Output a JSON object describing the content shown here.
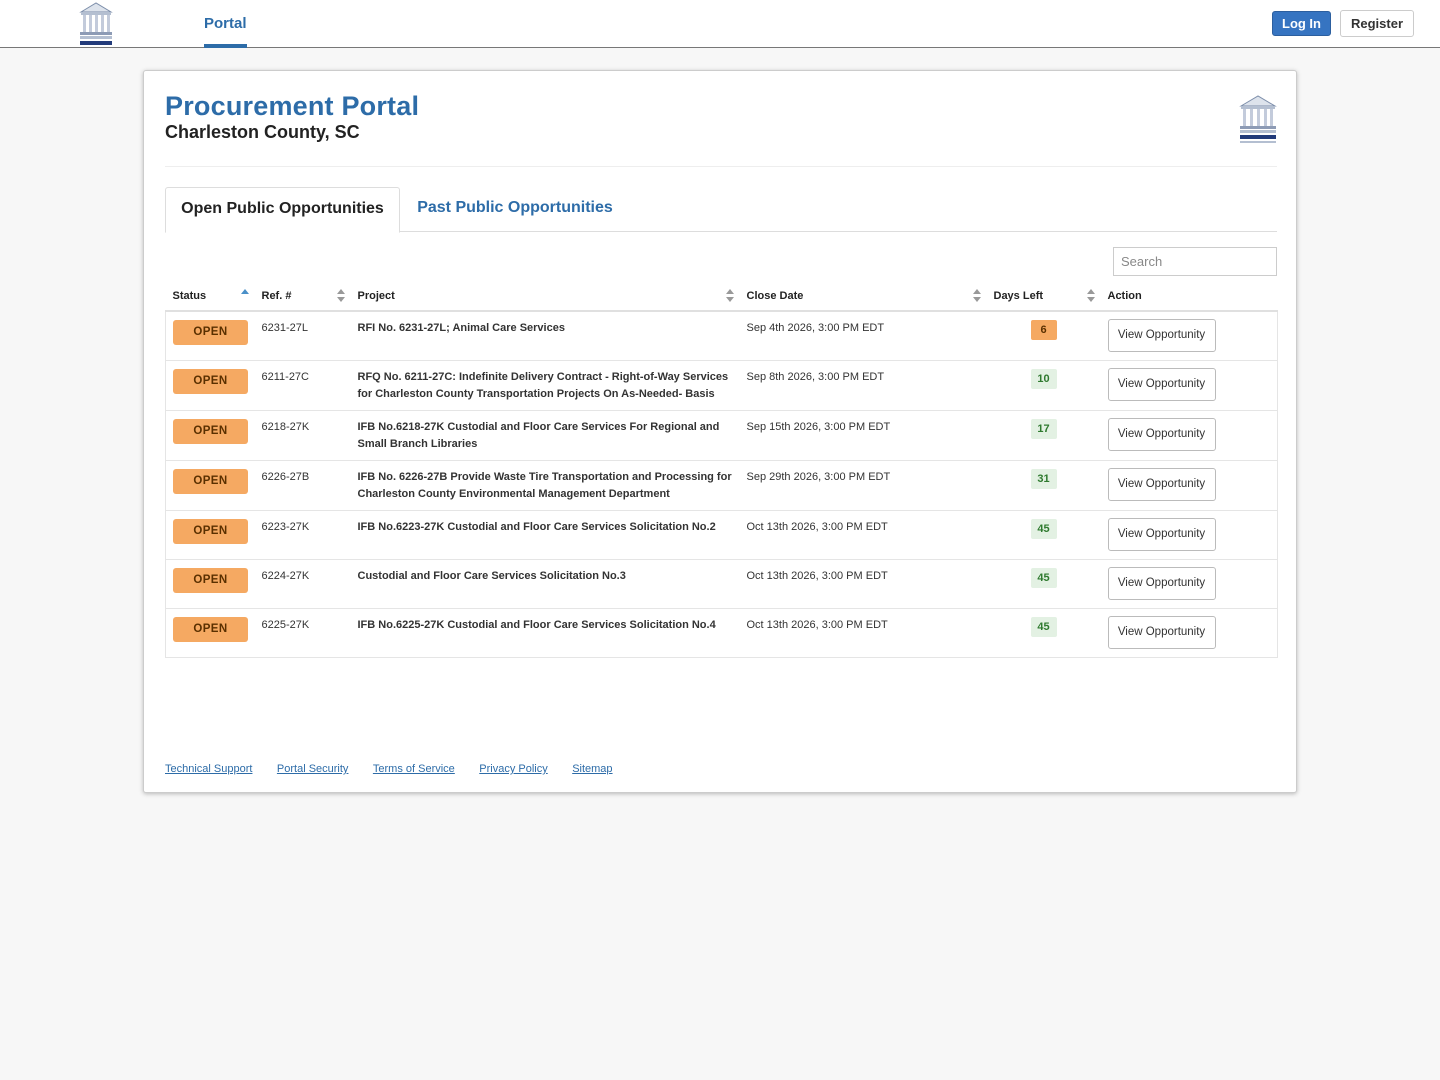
{
  "nav": {
    "logo_icon": "charleston-county-seal-icon",
    "portal_tab": "Portal",
    "login_label": "Log In",
    "register_label": "Register"
  },
  "header": {
    "title": "Procurement Portal",
    "subtitle": "Charleston County, SC",
    "logo_icon": "charleston-county-seal-icon"
  },
  "tabs": {
    "open_label": "Open Public Opportunities",
    "past_label": "Past Public Opportunities"
  },
  "search": {
    "placeholder": "Search"
  },
  "table": {
    "columns": {
      "status": "Status",
      "ref": "Ref. #",
      "project": "Project",
      "close_date": "Close Date",
      "days_left": "Days Left",
      "action": "Action"
    },
    "sorted_column": "Status",
    "sort_direction": "ascending",
    "rows": [
      {
        "status": "OPEN",
        "ref": "6231-27L",
        "project": "RFI No. 6231-27L; Animal Care Services",
        "close_date": "Sep 4th 2026, 3:00 PM EDT",
        "days_left": "6",
        "action": "View Opportunity"
      },
      {
        "status": "OPEN",
        "ref": "6211-27C",
        "project": "RFQ No. 6211-27C: Indefinite Delivery Contract - Right-of-Way Services for Charleston County Transportation Projects On As-Needed- Basis",
        "close_date": "Sep 8th 2026, 3:00 PM EDT",
        "days_left": "10",
        "action": "View Opportunity"
      },
      {
        "status": "OPEN",
        "ref": "6218-27K",
        "project": "IFB No.6218-27K Custodial and Floor Care Services For Regional and Small Branch Libraries",
        "close_date": "Sep 15th 2026, 3:00 PM EDT",
        "days_left": "17",
        "action": "View Opportunity"
      },
      {
        "status": "OPEN",
        "ref": "6226-27B",
        "project": "IFB No. 6226-27B Provide Waste Tire Transportation and Processing for Charleston County Environmental Management Department",
        "close_date": "Sep 29th 2026, 3:00 PM EDT",
        "days_left": "31",
        "action": "View Opportunity"
      },
      {
        "status": "OPEN",
        "ref": "6223-27K",
        "project": "IFB No.6223-27K Custodial and Floor Care Services Solicitation No.2",
        "close_date": "Oct 13th 2026, 3:00 PM EDT",
        "days_left": "45",
        "action": "View Opportunity"
      },
      {
        "status": "OPEN",
        "ref": "6224-27K",
        "project": "Custodial and Floor Care Services Solicitation No.3",
        "close_date": "Oct 13th 2026, 3:00 PM EDT",
        "days_left": "45",
        "action": "View Opportunity"
      },
      {
        "status": "OPEN",
        "ref": "6225-27K",
        "project": "IFB No.6225-27K Custodial and Floor Care Services Solicitation No.4",
        "close_date": "Oct 13th 2026, 3:00 PM EDT",
        "days_left": "45",
        "action": "View Opportunity"
      }
    ]
  },
  "footer": {
    "links": [
      "Technical Support",
      "Portal Security",
      "Terms of Service",
      "Privacy Policy",
      "Sitemap"
    ]
  },
  "colors": {
    "brand_blue": "#2d6ca8",
    "login_button": "#3674c1",
    "open_badge": "#f5a962",
    "days_warning": "#f5a962",
    "days_ok": "#e3f1e3",
    "page_background": "#f7f7f7"
  }
}
